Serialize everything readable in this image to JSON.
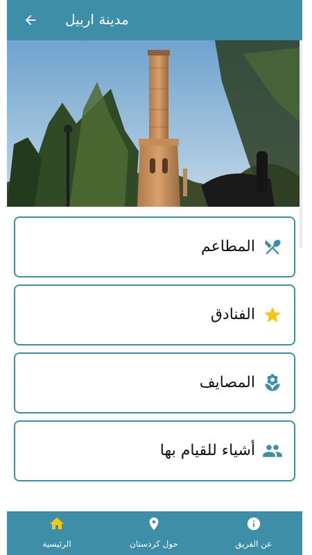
{
  "app": {
    "title": "مدينة اربيل",
    "back_icon": "arrow-back-icon",
    "bar_color": "#3d8ea6"
  },
  "hero": {
    "icon": "minaret-photo"
  },
  "categories": [
    {
      "label": "المطاعم",
      "icon": "restaurant-icon",
      "icon_color": "#3d8ea6"
    },
    {
      "label": "الفنادق",
      "icon": "star-icon",
      "icon_color": "#f5c518"
    },
    {
      "label": "المصايف",
      "icon": "tulip-icon",
      "icon_color": "#3d8ea6"
    },
    {
      "label": "أشياء للقيام بها",
      "icon": "people-icon",
      "icon_color": "#3d8ea6"
    }
  ],
  "bottom_nav": {
    "items": [
      {
        "label": "عن الفريق",
        "icon": "info-icon",
        "active": false
      },
      {
        "label": "حول كردستان",
        "icon": "location-pin-icon",
        "active": false
      },
      {
        "label": "الرئيسية",
        "icon": "home-icon",
        "active": true
      }
    ],
    "active_icon_color": "#f5c518"
  }
}
